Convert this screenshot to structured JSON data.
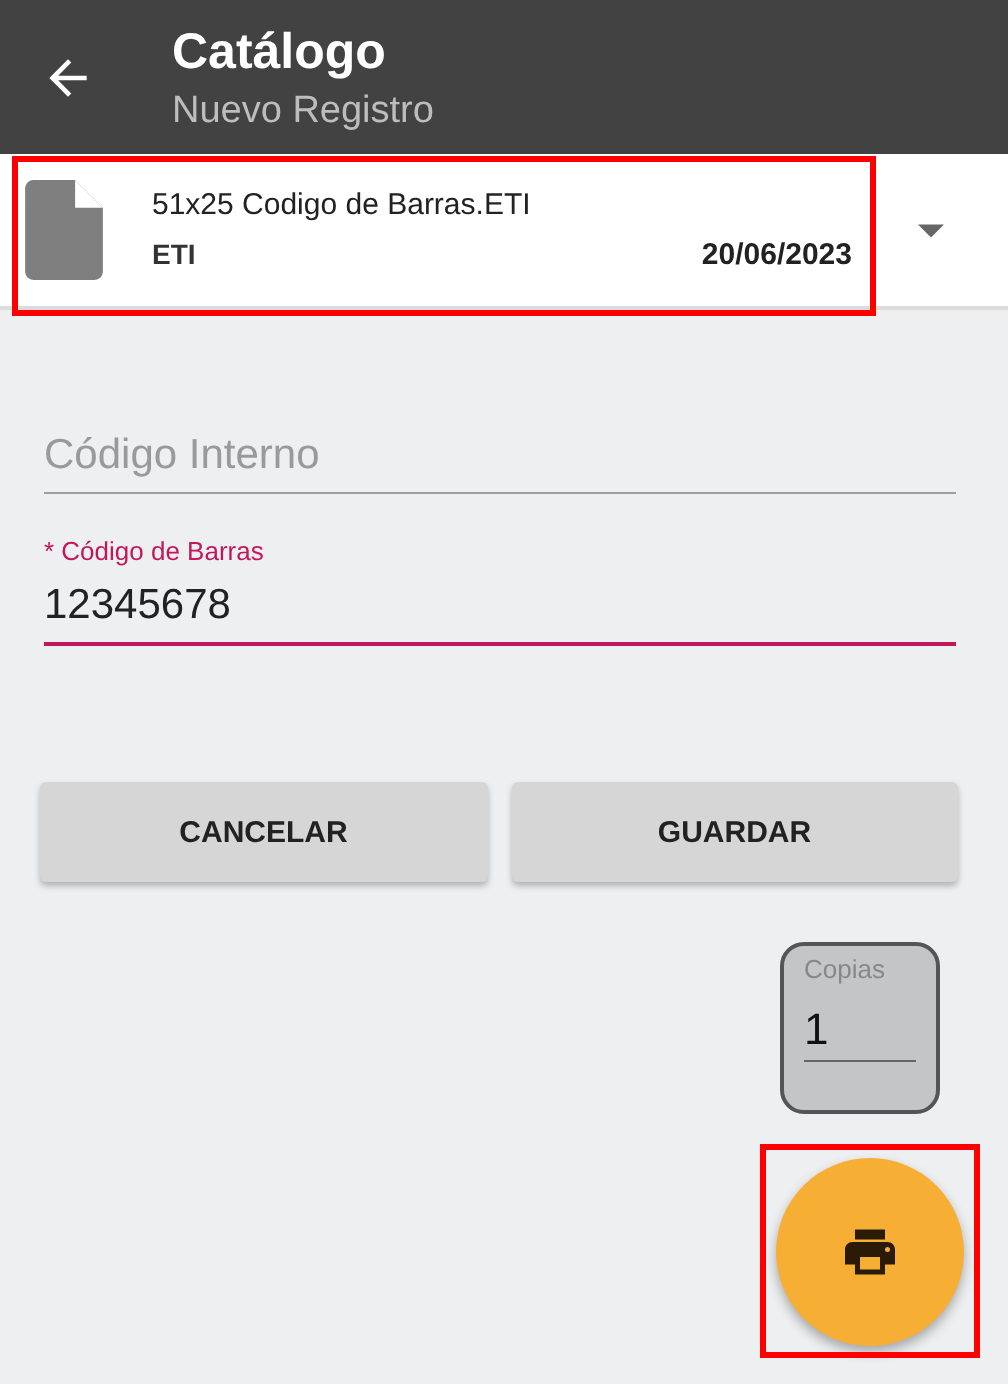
{
  "app_bar": {
    "title": "Catálogo",
    "subtitle": "Nuevo Registro"
  },
  "file_selector": {
    "name": "51x25 Codigo de Barras.ETI",
    "type": "ETI",
    "date": "20/06/2023",
    "highlighted": true
  },
  "fields": [
    {
      "placeholder": "Código Interno",
      "focused": false
    },
    {
      "label": "* Código de Barras",
      "value": "12345678",
      "focused": true
    }
  ],
  "buttons": [
    "CANCELAR",
    "GUARDAR"
  ],
  "copies": {
    "label": "Copias",
    "value": "1"
  },
  "print_button": {
    "highlighted": true
  }
}
